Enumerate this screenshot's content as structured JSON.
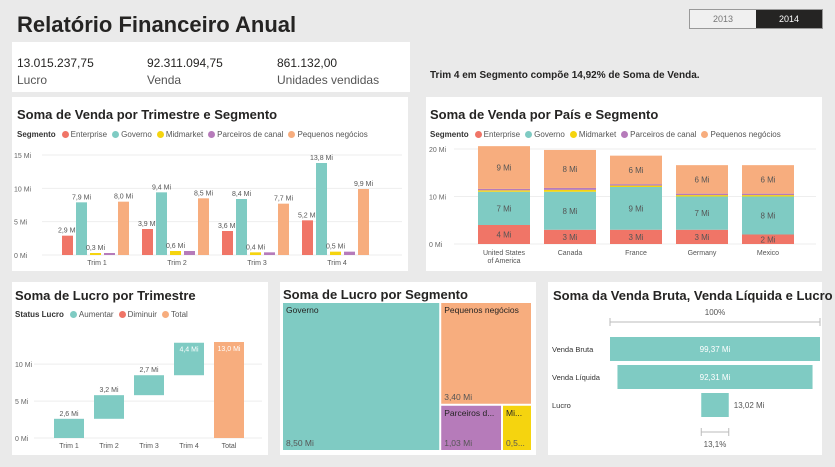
{
  "title": "Relatório Financeiro Anual",
  "years": [
    "2013",
    "2014"
  ],
  "selected_year": "2014",
  "kpis": [
    {
      "value": "13.015.237,75",
      "label": "Lucro"
    },
    {
      "value": "92.311.094,75",
      "label": "Venda"
    },
    {
      "value": "861.132,00",
      "label": "Unidades vendidas"
    }
  ],
  "insight": "Trim 4 em Segmento  compõe 14,92% de Soma de Venda.",
  "colors": {
    "Enterprise": "#f07567",
    "Governo": "#7fcbc3",
    "Midmarket": "#f5d40f",
    "Parceiros de canal": "#b67bba",
    "Pequenos negócios": "#f7ad7e",
    "Aumentar": "#7fcbc3",
    "Diminuir": "#f07567",
    "Total": "#f7ad7e"
  },
  "segment_legend": {
    "title": "Segmento",
    "items": [
      "Enterprise",
      "Governo",
      "Midmarket",
      "Parceiros de canal",
      "Pequenos negócios"
    ]
  },
  "chart_data": [
    {
      "id": "quarter_segment",
      "type": "bar",
      "title": "Soma de Venda por Trimestre e Segmento",
      "categories": [
        "Trim 1",
        "Trim 2",
        "Trim 3",
        "Trim 4"
      ],
      "yticks": [
        "15 Mi",
        "10 Mi",
        "5 Mi",
        "0 Mi"
      ],
      "ylim": [
        0,
        15
      ],
      "series": [
        {
          "name": "Enterprise",
          "values": [
            2.9,
            3.9,
            3.6,
            5.2
          ],
          "labels": [
            "2,9 Mi",
            "3,9 Mi",
            "3,6 Mi",
            "5,2 Mi"
          ]
        },
        {
          "name": "Governo",
          "values": [
            7.9,
            9.4,
            8.4,
            13.8
          ],
          "labels": [
            "7,9 Mi",
            "9,4 Mi",
            "8,4 Mi",
            "13,8 Mi"
          ]
        },
        {
          "name": "Midmarket",
          "values": [
            0.3,
            0.6,
            0.4,
            0.5
          ],
          "labels": [
            "0,3 Mi",
            "0,6 Mi",
            "0,4 Mi",
            "0,5 Mi"
          ]
        },
        {
          "name": "Parceiros de canal",
          "values": [
            0.3,
            0.6,
            0.4,
            0.5
          ],
          "labels": [
            "",
            "",
            "",
            ""
          ]
        },
        {
          "name": "Pequenos negócios",
          "values": [
            8.0,
            8.5,
            7.7,
            9.9
          ],
          "labels": [
            "8,0 Mi",
            "8,5 Mi",
            "7,7 Mi",
            "9,9 Mi"
          ]
        }
      ]
    },
    {
      "id": "country_segment",
      "type": "bar",
      "stacked": true,
      "title": "Soma de Venda por País e Segmento",
      "categories": [
        "United States of America",
        "Canada",
        "France",
        "Germany",
        "Mexico"
      ],
      "category_lines": [
        [
          "United States",
          "of America"
        ],
        [
          "Canada"
        ],
        [
          "France"
        ],
        [
          "Germany"
        ],
        [
          "Mexico"
        ]
      ],
      "yticks": [
        "20 Mi",
        "10 Mi",
        "0 Mi"
      ],
      "ylim": [
        0,
        20
      ],
      "series": [
        {
          "name": "Enterprise",
          "values": [
            4,
            3,
            3,
            3,
            2
          ],
          "labels": [
            "4 Mi",
            "3 Mi",
            "3 Mi",
            "3 Mi",
            "2 Mi"
          ]
        },
        {
          "name": "Governo",
          "values": [
            7,
            8,
            9,
            7,
            8
          ],
          "labels": [
            "7 Mi",
            "8 Mi",
            "9 Mi",
            "7 Mi",
            "8 Mi"
          ]
        },
        {
          "name": "Midmarket",
          "values": [
            0.3,
            0.4,
            0.3,
            0.3,
            0.3
          ],
          "labels": [
            "",
            "",
            "",
            "",
            ""
          ]
        },
        {
          "name": "Parceiros de canal",
          "values": [
            0.3,
            0.4,
            0.3,
            0.3,
            0.3
          ],
          "labels": [
            "",
            "",
            "",
            "",
            ""
          ]
        },
        {
          "name": "Pequenos negócios",
          "values": [
            9,
            8,
            6,
            6,
            6
          ],
          "labels": [
            "9 Mi",
            "8 Mi",
            "6 Mi",
            "6 Mi",
            "6 Mi"
          ]
        }
      ]
    },
    {
      "id": "profit_waterfall",
      "type": "bar",
      "subtype": "waterfall",
      "title": "Soma de Lucro por Trimestre",
      "legend_title": "Status Lucro",
      "legend": [
        "Aumentar",
        "Diminuir",
        "Total"
      ],
      "categories": [
        "Trim 1",
        "Trim 2",
        "Trim 3",
        "Trim 4",
        "Total"
      ],
      "values": [
        2.6,
        3.2,
        2.7,
        4.4,
        13.0
      ],
      "labels": [
        "2,6 Mi",
        "3,2 Mi",
        "2,7 Mi",
        "4,4 Mi",
        "13,0 Mi"
      ],
      "yticks": [
        "10 Mi",
        "5 Mi",
        "0 Mi"
      ],
      "ylim": [
        0,
        13
      ]
    },
    {
      "id": "profit_treemap",
      "type": "heatmap",
      "subtype": "treemap",
      "title": "Soma de Lucro por Segmento",
      "items": [
        {
          "name": "Governo",
          "value": 8.5,
          "label": "8,50 Mi"
        },
        {
          "name": "Pequenos negócios",
          "value": 3.4,
          "label": "3,40 Mi"
        },
        {
          "name": "Parceiros d...",
          "value": 1.03,
          "label": "1,03 Mi"
        },
        {
          "name": "Mi...",
          "value": 0.5,
          "label": "0,5..."
        }
      ]
    },
    {
      "id": "funnel",
      "type": "bar",
      "subtype": "funnel",
      "title": "Soma da Venda Bruta, Venda Líquida e Lucro",
      "categories": [
        "Venda Bruta",
        "Venda Líquida",
        "Lucro"
      ],
      "values": [
        99.37,
        92.31,
        13.02
      ],
      "labels": [
        "99,37 Mi",
        "92,31 Mi",
        "13,02 Mi"
      ],
      "top_pct": "100%",
      "bottom_pct": "13,1%"
    }
  ]
}
